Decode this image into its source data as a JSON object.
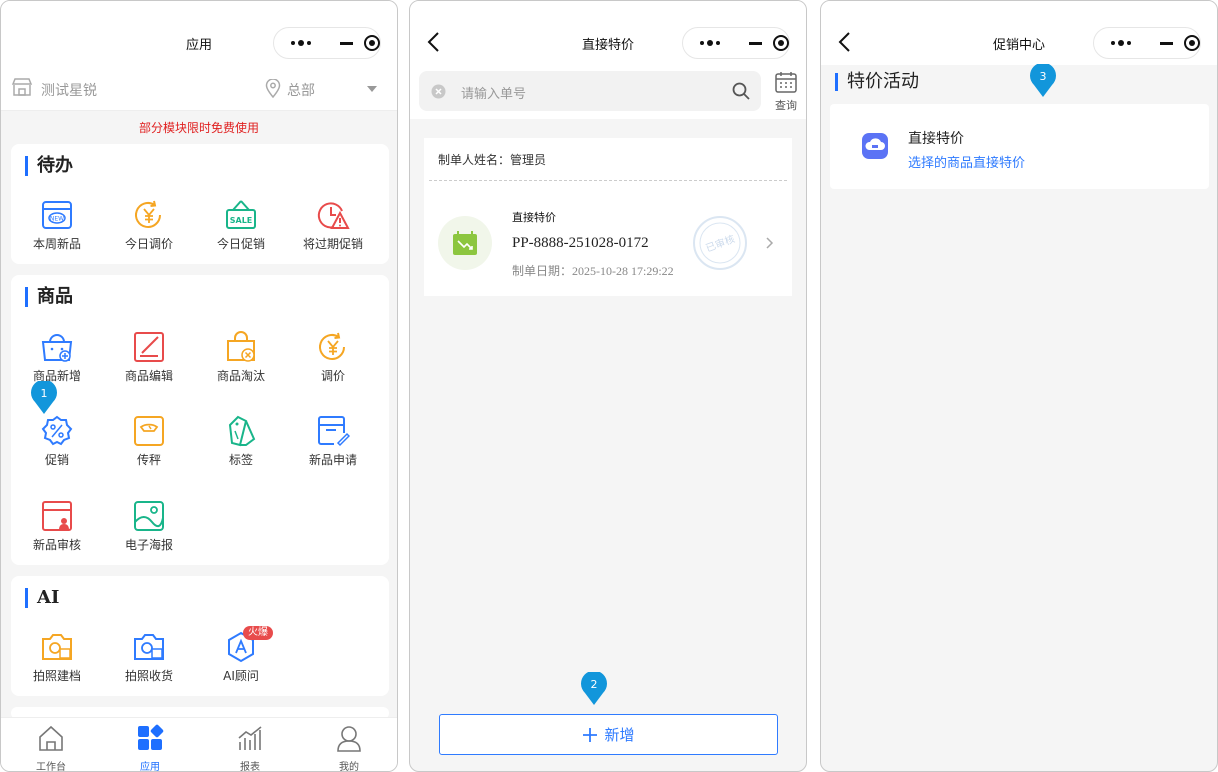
{
  "panel1": {
    "nav_title": "应用",
    "store": "测试星锐",
    "location": "总部",
    "notice": "部分模块限时免费使用",
    "sections": [
      {
        "title": "待办",
        "items": [
          "本周新品",
          "今日调价",
          "今日促销",
          "将过期促销"
        ]
      },
      {
        "title": "商品",
        "items": [
          "商品新增",
          "商品编辑",
          "商品淘汰",
          "调价",
          "促销",
          "传秤",
          "标签",
          "新品申请",
          "新品审核",
          "电子海报"
        ]
      },
      {
        "title": "AI",
        "items": [
          "拍照建档",
          "拍照收货",
          "AI顾问"
        ]
      }
    ],
    "hot_badge": "火爆",
    "icon_text_new": "NEW",
    "icon_text_sale": "SALE",
    "tabs": [
      "工作台",
      "应用",
      "报表",
      "我的"
    ],
    "active_tab": "应用",
    "step_marker": "1"
  },
  "panel2": {
    "nav_title": "直接特价",
    "search_placeholder": "请输入单号",
    "query_label": "查询",
    "maker": "制单人姓名：管理员",
    "order": {
      "type": "直接特价",
      "number": "PP-8888-251028-0172",
      "date": "制单日期：2025-10-28 17:29:22",
      "stamp": "已审核"
    },
    "add_button": "新增",
    "step_marker": "2"
  },
  "panel3": {
    "nav_title": "促销中心",
    "section_title": "特价活动",
    "promo": {
      "name": "直接特价",
      "desc": "选择的商品直接特价"
    },
    "step_marker": "3"
  },
  "colors": {
    "accent": "#1e6fff",
    "marker": "#1296db",
    "notice": "#e02020"
  }
}
